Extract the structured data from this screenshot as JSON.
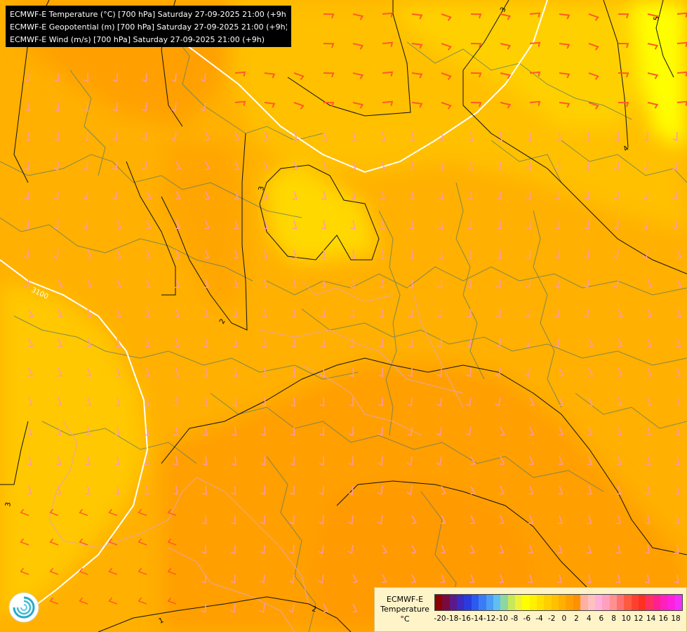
{
  "titles": [
    "ECMWF-E Temperature (°C) [700 hPa] Saturday 27-09-2025 21:00 (+9h)",
    "ECMWF-E Geopotential (m) [700 hPa] Saturday 27-09-2025 21:00 (+9h)",
    "ECMWF-E Wind (m/s) [700 hPa] Saturday 27-09-2025 21:00 (+9h)"
  ],
  "contour_labels": {
    "isotherm_3_top": "3",
    "isotherm_5_top": "5",
    "isotherm_3_center": "3",
    "isotherm_2": "2",
    "isotherm_4": "4",
    "isotherm_3_left": "3",
    "isotherm_1": "1",
    "isotherm_2_bottom": "2",
    "geopotential_3100": "3100"
  },
  "legend": {
    "title_lines": [
      "ECMWF-E",
      "Temperature",
      "°C"
    ],
    "colors": [
      "#8b0000",
      "#7a0a3d",
      "#5a1a8a",
      "#3a2abf",
      "#2a3add",
      "#2a5bf0",
      "#3a7cf5",
      "#4a9ef5",
      "#5fc0f0",
      "#8ed7a0",
      "#c8e85a",
      "#f0f03a",
      "#ffff00",
      "#fff000",
      "#ffe000",
      "#ffd000",
      "#ffc000",
      "#ffb000",
      "#ffa000",
      "#ff9000",
      "#ffb0a0",
      "#ffc0c0",
      "#ffb0d8",
      "#ffa0c0",
      "#ff9090",
      "#ff7070",
      "#ff5a40",
      "#ff4030",
      "#ff3020",
      "#ff3060",
      "#ff2090",
      "#ff20c0",
      "#ff20e0",
      "#f030f8"
    ],
    "tick_labels": [
      "-20",
      "-18",
      "-16",
      "-14",
      "-12",
      "-10",
      "-8",
      "-6",
      "-4",
      "-2",
      "0",
      "2",
      "4",
      "6",
      "8",
      "10",
      "12",
      "14",
      "16",
      "18"
    ]
  },
  "field_colors": {
    "base": "#ffb000",
    "warm": "#ff9f00",
    "cool": "#ffc000",
    "cooler": "#ffd200",
    "coolest": "#ffe100",
    "yellow_corner": "#ffff00"
  },
  "logo_name": "ecmwf-logo"
}
